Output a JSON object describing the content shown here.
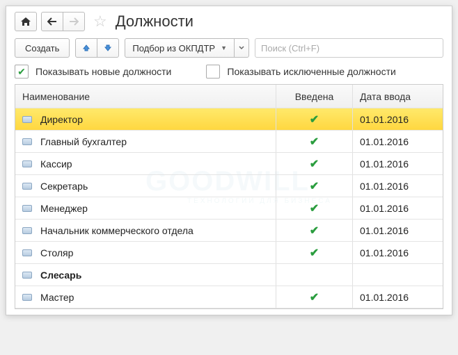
{
  "title": "Должности",
  "toolbar": {
    "create": "Создать",
    "pick": "Подбор из ОКПДТР",
    "search_placeholder": "Поиск (Ctrl+F)"
  },
  "filters": {
    "show_new": "Показывать новые должности",
    "show_excl": "Показывать исключенные должности"
  },
  "columns": {
    "name": "Наименование",
    "entered": "Введена",
    "date": "Дата ввода"
  },
  "rows": [
    {
      "name": "Директор",
      "entered": true,
      "date": "01.01.2016",
      "sel": true,
      "bold": false
    },
    {
      "name": "Главный бухгалтер",
      "entered": true,
      "date": "01.01.2016",
      "sel": false,
      "bold": false
    },
    {
      "name": "Кассир",
      "entered": true,
      "date": "01.01.2016",
      "sel": false,
      "bold": false
    },
    {
      "name": "Секретарь",
      "entered": true,
      "date": "01.01.2016",
      "sel": false,
      "bold": false
    },
    {
      "name": "Менеджер",
      "entered": true,
      "date": "01.01.2016",
      "sel": false,
      "bold": false
    },
    {
      "name": "Начальник коммерческого отдела",
      "entered": true,
      "date": "01.01.2016",
      "sel": false,
      "bold": false
    },
    {
      "name": "Столяр",
      "entered": true,
      "date": "01.01.2016",
      "sel": false,
      "bold": false
    },
    {
      "name": "Слесарь",
      "entered": false,
      "date": "",
      "sel": false,
      "bold": true
    },
    {
      "name": "Мастер",
      "entered": true,
      "date": "01.01.2016",
      "sel": false,
      "bold": false
    }
  ],
  "watermark": {
    "main": "GOODWILL",
    "sub": "ТЕХНОЛОГИИ ДЛЯ БИЗНЕСА"
  }
}
